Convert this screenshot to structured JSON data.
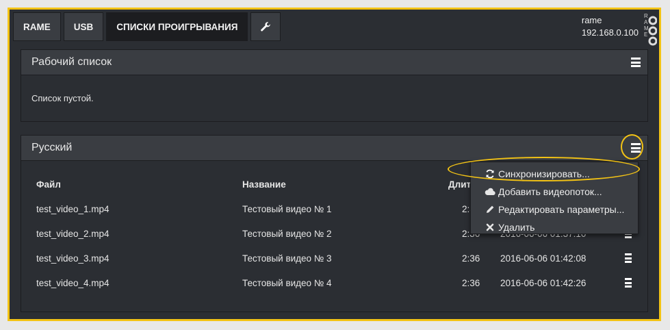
{
  "nav": {
    "tabs": [
      {
        "label": "RAME"
      },
      {
        "label": "USB"
      },
      {
        "label": "СПИСКИ ПРОИГРЫВАНИЯ"
      }
    ],
    "tools_icon": "wrench-icon"
  },
  "host": {
    "name": "rame",
    "ip": "192.168.0.100"
  },
  "logo_text": "RAME",
  "work_list": {
    "title": "Рабочий список",
    "empty_text": "Список пустой."
  },
  "playlist": {
    "title": "Русский",
    "columns": {
      "file": "Файл",
      "name": "Название",
      "duration": "Длительность",
      "date": ""
    },
    "rows": [
      {
        "file": "test_video_1.mp4",
        "name": "Тестовый видео № 1",
        "duration": "2:36",
        "date": ""
      },
      {
        "file": "test_video_2.mp4",
        "name": "Тестовый видео № 2",
        "duration": "2:36",
        "date": "2016-06-06 01:37:10"
      },
      {
        "file": "test_video_3.mp4",
        "name": "Тестовый видео № 3",
        "duration": "2:36",
        "date": "2016-06-06 01:42:08"
      },
      {
        "file": "test_video_4.mp4",
        "name": "Тестовый видео № 4",
        "duration": "2:36",
        "date": "2016-06-06 01:42:26"
      }
    ]
  },
  "dropdown": {
    "items": [
      {
        "label": "Синхронизировать...",
        "icon": "refresh-icon"
      },
      {
        "label": "Добавить видеопоток...",
        "icon": "cloud-icon"
      },
      {
        "label": "Редактировать параметры...",
        "icon": "pencil-icon"
      },
      {
        "label": "Удалить",
        "icon": "close-icon"
      }
    ]
  },
  "colors": {
    "accent_highlight": "#f3c315",
    "panel_bg": "#2b2e33",
    "header_bg": "#3a3d42"
  }
}
